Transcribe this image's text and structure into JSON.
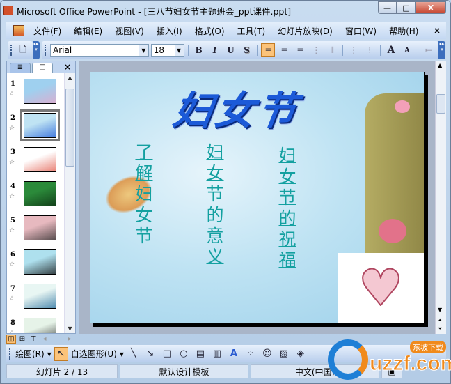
{
  "window": {
    "title": "Microsoft Office PowerPoint - [三八节妇女节主题班会_ppt课件.ppt]",
    "minimize": "—",
    "restore": "□",
    "close": "X"
  },
  "menu": [
    "文件(F)",
    "编辑(E)",
    "视图(V)",
    "插入(I)",
    "格式(O)",
    "工具(T)",
    "幻灯片放映(D)",
    "窗口(W)",
    "帮助(H)"
  ],
  "menu_close": "×",
  "format_toolbar": {
    "font": "Arial",
    "size": "18",
    "bold": "B",
    "italic": "I",
    "underline": "U",
    "shadow": "S",
    "align_left": "≡",
    "center": "≡",
    "align_right": "≡",
    "grow": "A",
    "shrink": "A"
  },
  "panel": {
    "tab_outline": "≣",
    "tab_slides": "□",
    "close": "×",
    "star": "☆",
    "slides": [
      {
        "num": "1",
        "colors": [
          "#9fd0ef",
          "#e9a5c8"
        ]
      },
      {
        "num": "2",
        "colors": [
          "#bfe3f3",
          "#1c5ad8"
        ]
      },
      {
        "num": "3",
        "colors": [
          "#ffffff",
          "#e25a4a"
        ]
      },
      {
        "num": "4",
        "colors": [
          "#2b8a3a",
          "#0b2a10"
        ]
      },
      {
        "num": "5",
        "colors": [
          "#e7b9bf",
          "#2a2a2a"
        ]
      },
      {
        "num": "6",
        "colors": [
          "#aee0ee",
          "#101010"
        ]
      },
      {
        "num": "7",
        "colors": [
          "#e8f6f3",
          "#1f6a9a"
        ]
      },
      {
        "num": "8",
        "colors": [
          "#e6f3e8",
          "#111111"
        ]
      }
    ]
  },
  "slide": {
    "title": "妇女节",
    "columns": [
      [
        "了",
        "解",
        "妇",
        "女",
        "节"
      ],
      [
        "妇",
        "女",
        "节",
        "的",
        "意",
        "义"
      ],
      [
        "妇",
        "女",
        "节",
        "的",
        "祝",
        "福"
      ]
    ],
    "heart": "♥"
  },
  "drawing_toolbar": {
    "draw": "绘图(R)",
    "autoshapes": "自选图形(U)"
  },
  "status": {
    "slide": "幻灯片 2 / 13",
    "design": "默认设计模板",
    "language": "中文(中国)"
  },
  "watermark": {
    "site": "uzzf.com",
    "badge": "东坡下载"
  }
}
